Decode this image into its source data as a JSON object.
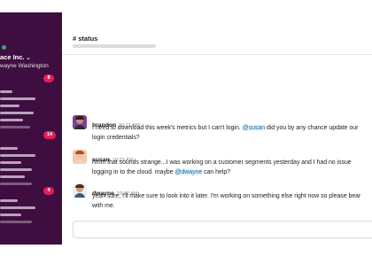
{
  "workspace": {
    "name": "ace Inc.",
    "chevron": "⌄",
    "user": "wayne Washington",
    "presence_color": "#2bac76"
  },
  "sidebar": {
    "badges": [
      {
        "count": "8"
      },
      {
        "count": "14"
      },
      {
        "count": "4"
      }
    ],
    "badge_color": "#e01e5a",
    "background_color": "#3f0e40"
  },
  "channel": {
    "title": "# status"
  },
  "messages": [
    {
      "author": "brandon",
      "time": "10:21 AM",
      "text_before": "I need to download this week's metrics but I can't login. ",
      "mention": "@susan",
      "text_after": " did you by any chance update our login credentials?"
    },
    {
      "author": "susan",
      "time": "10:23 AM",
      "text_before": "hmm that sounds strange...I was working on a customer segments yesterday and I had no issue logging in to the cloud. maybe ",
      "mention": "@dwayne",
      "text_after": " can help?"
    },
    {
      "author": "dwayne",
      "time": "10:32 AM",
      "text_before": "yeah sure, I'll make sure to look into it later. I'm working on something else right now so please bear with me.",
      "mention": "",
      "text_after": ""
    }
  ],
  "icons": {
    "presence": "presence-dot-icon",
    "chevron": "chevron-down-icon"
  }
}
